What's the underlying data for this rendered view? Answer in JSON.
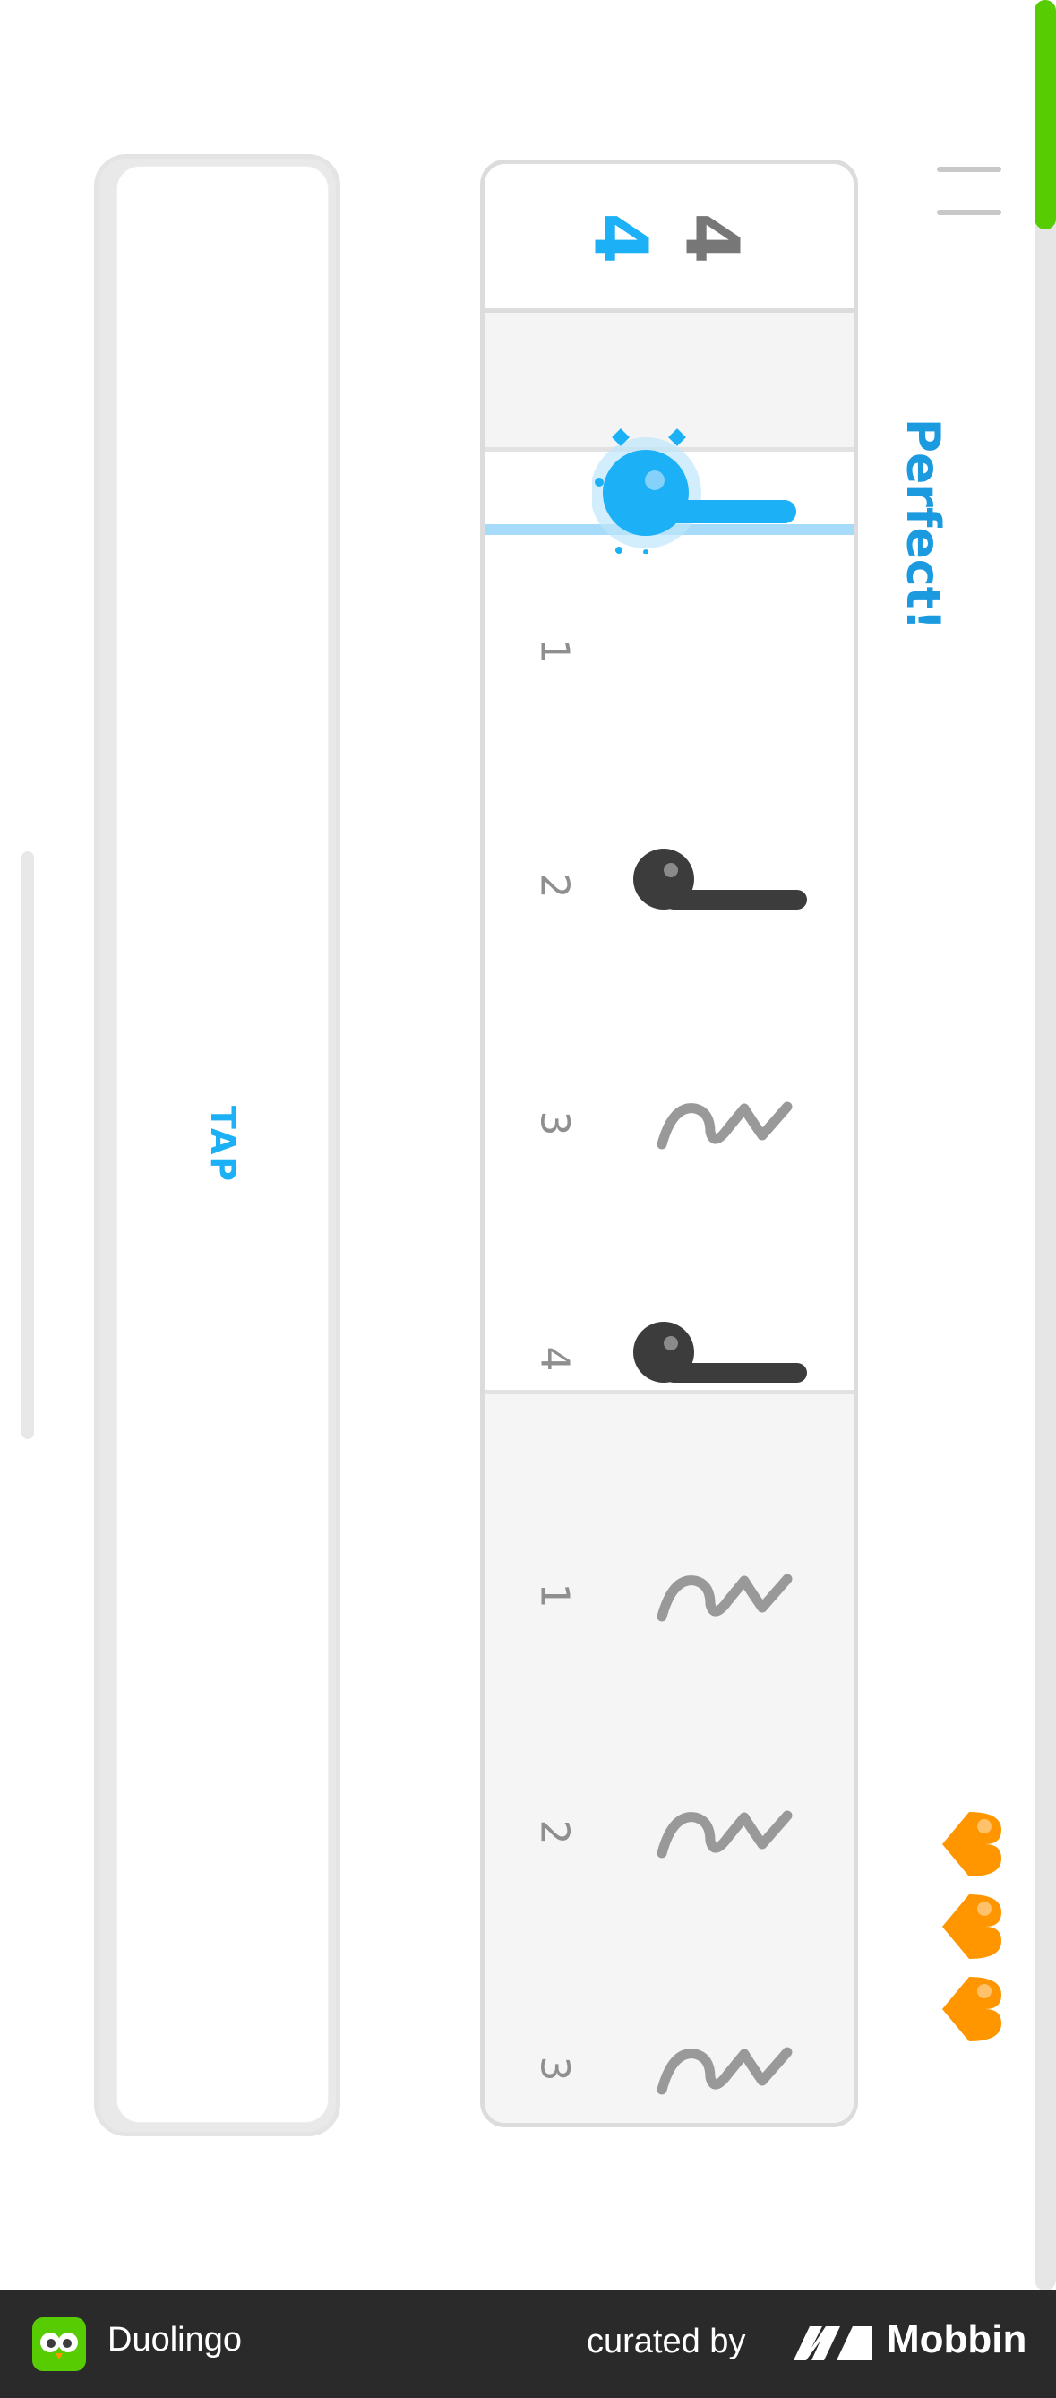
{
  "tap_pad": {
    "label": "TAP"
  },
  "feedback": {
    "text": "Perfect!"
  },
  "staff": {
    "time_signature": {
      "top": "4",
      "bottom": "4"
    },
    "beats": [
      {
        "count": "1",
        "symbol": "quarter-note-icon",
        "state": "played"
      },
      {
        "count": "2",
        "symbol": "quarter-note-icon",
        "state": "upcoming"
      },
      {
        "count": "3",
        "symbol": "quarter-rest-icon",
        "state": "upcoming"
      },
      {
        "count": "4",
        "symbol": "quarter-note-icon",
        "state": "upcoming"
      },
      {
        "count": "1",
        "symbol": "quarter-rest-icon",
        "state": "next-measure"
      },
      {
        "count": "2",
        "symbol": "quarter-rest-icon",
        "state": "next-measure"
      },
      {
        "count": "3",
        "symbol": "quarter-rest-icon",
        "state": "next-measure"
      }
    ]
  },
  "hearts": {
    "count": 3
  },
  "progress": {
    "fraction": 0.1
  },
  "footer": {
    "app_name": "Duolingo",
    "curated_by": "curated by",
    "mobbin": "Mobbin"
  },
  "colors": {
    "accent_blue": "#1cb0f6",
    "progress_green": "#58cc02",
    "heart_orange": "#ff9600",
    "note_dark": "#3c3c3c",
    "rest_gray": "#999999"
  }
}
